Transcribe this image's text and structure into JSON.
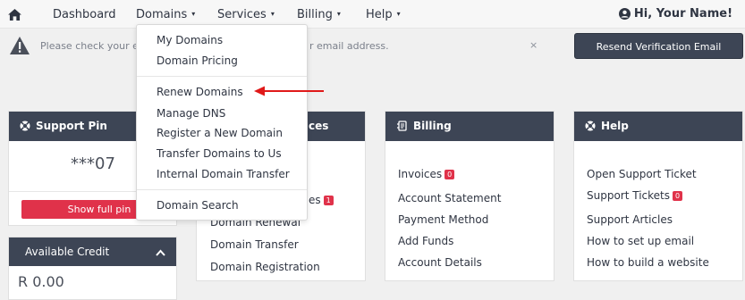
{
  "navbar": {
    "items": [
      {
        "label": "Dashboard",
        "caret": false
      },
      {
        "label": "Domains",
        "caret": true
      },
      {
        "label": "Services",
        "caret": true
      },
      {
        "label": "Billing",
        "caret": true
      },
      {
        "label": "Help",
        "caret": true
      }
    ],
    "user_label": "Hi, Your Name!",
    "caret_glyph": "▾"
  },
  "alert": {
    "text_left": "Please check your e",
    "text_right": "r email address.",
    "close": "×",
    "resend_label": "Resend Verification Email"
  },
  "support_pin": {
    "title": "Support Pin",
    "value": "***07",
    "button": "Show full pin"
  },
  "credit": {
    "title": "Available Credit",
    "value": "R 0.00"
  },
  "services_panel": {
    "title_fragment": "ces",
    "links": [
      "es",
      "Domain Renewal",
      "Domain Transfer",
      "Domain Registration"
    ],
    "badge": "1"
  },
  "billing_panel": {
    "title": "Billing",
    "links": [
      "Invoices",
      "Account Statement",
      "Payment Method",
      "Add Funds",
      "Account Details"
    ],
    "invoice_badge": "0"
  },
  "help_panel": {
    "title": "Help",
    "links": [
      "Open Support Ticket",
      "Support Tickets",
      "Support Articles",
      "How to set up email",
      "How to build a website"
    ],
    "ticket_badge": "0"
  },
  "domains_dropdown": {
    "group1": [
      "My Domains",
      "Domain Pricing"
    ],
    "group2": [
      "Renew Domains",
      "Manage DNS",
      "Register a New Domain",
      "Transfer Domains to Us",
      "Internal Domain Transfer"
    ],
    "group3": [
      "Domain Search"
    ]
  },
  "colors": {
    "panel_header": "#3d4555",
    "accent_red": "#e0324a",
    "arrow": "#e01919"
  }
}
